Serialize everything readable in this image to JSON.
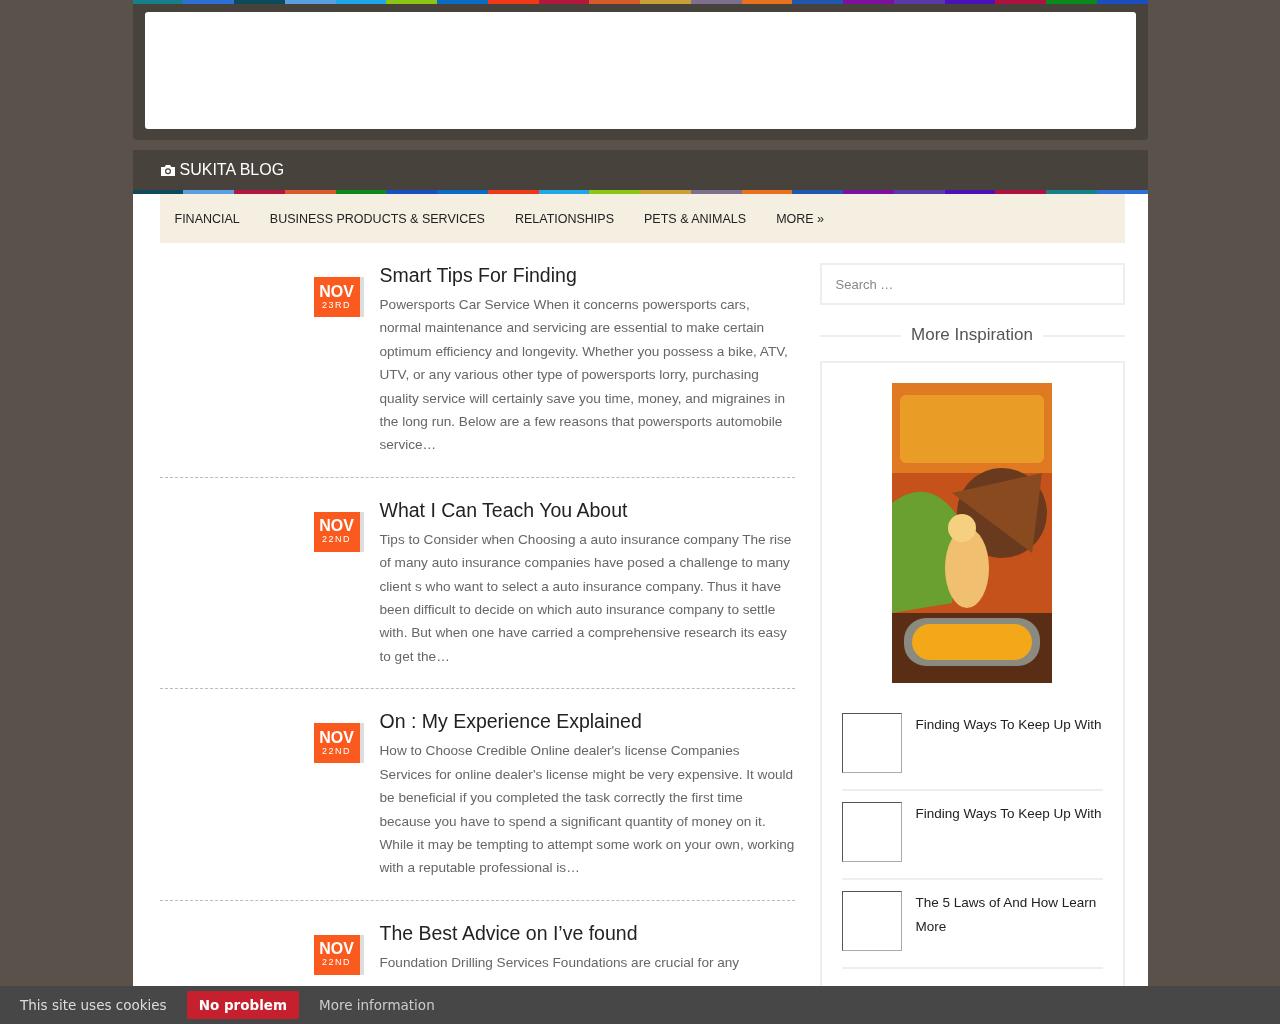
{
  "site": {
    "title": "SUKITA BLOG"
  },
  "menu": [
    {
      "label": "FINANCIAL"
    },
    {
      "label": "BUSINESS PRODUCTS & SERVICES"
    },
    {
      "label": "RELATIONSHIPS"
    },
    {
      "label": "PETS & ANIMALS"
    },
    {
      "label": "MORE »"
    }
  ],
  "posts": [
    {
      "month": "NOV",
      "day": "23RD",
      "title": "Smart Tips For Finding",
      "excerpt": "Powersports Car Service When it concerns powersports cars, normal maintenance and servicing are essential to make certain optimum efficiency and longevity. Whether you possess a bike, ATV, UTV, or any various other type of powersports lorry, purchasing quality service will certainly save you time, money, and migraines in the long run. Below are a few reasons that powersports automobile service…"
    },
    {
      "month": "NOV",
      "day": "22ND",
      "title": "What I Can Teach You About",
      "excerpt": "Tips to Consider when Choosing a auto insurance company The rise of many auto insurance companies have posed a challenge to many client s who want to select a auto insurance company. Thus it have been difficult to decide on which auto insurance company to settle with. But when one have carried a comprehensive research its easy to get the…"
    },
    {
      "month": "NOV",
      "day": "22ND",
      "title": "On : My Experience Explained",
      "excerpt": "How to Choose Credible Online dealer's license Companies Services for online dealer's license might be very expensive. It would be beneficial if you completed the task correctly the first time because you have to spend a significant quantity of money on it. While it may be tempting to attempt some work on your own, working with a reputable professional is…"
    },
    {
      "month": "NOV",
      "day": "22ND",
      "title": "The Best Advice on I’ve found",
      "excerpt": "Foundation Drilling Services Foundations are crucial for any"
    }
  ],
  "sidebar": {
    "search": {
      "placeholder": "Search …"
    },
    "heading": "More Inspiration",
    "items": [
      {
        "title": "Finding Ways To Keep Up With"
      },
      {
        "title": "Finding Ways To Keep Up With"
      },
      {
        "title": "The 5 Laws of And How Learn More"
      }
    ]
  },
  "cookie_bar": {
    "message": "This site uses cookies",
    "button": "No problem",
    "link": "More information"
  }
}
